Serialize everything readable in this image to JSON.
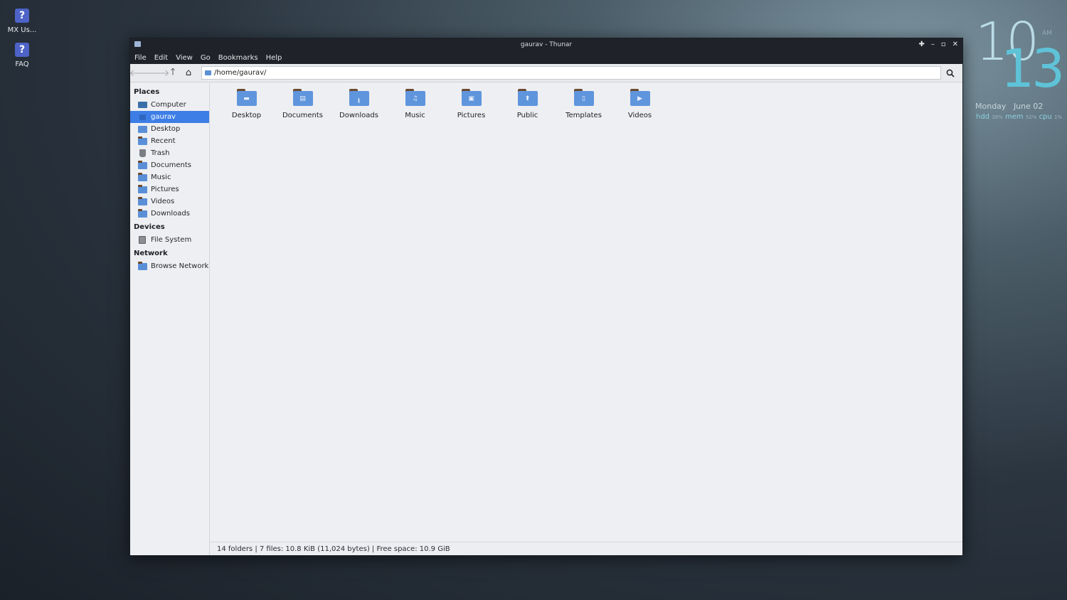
{
  "desktop": {
    "icons": [
      {
        "label": "MX Us...",
        "glyph": "?"
      },
      {
        "label": "FAQ",
        "glyph": "?"
      }
    ]
  },
  "clock": {
    "hour": "10",
    "minute": "13",
    "ampm": "AM",
    "day": "Monday",
    "date": "June 02",
    "hdd_label": "hdd",
    "hdd_value": "38%",
    "mem_label": "mem",
    "mem_value": "52%",
    "cpu_label": "cpu",
    "cpu_value": "1%"
  },
  "window": {
    "title": "gaurav - Thunar",
    "controls": {
      "pin": "✚",
      "minimize": "–",
      "maximize": "▫",
      "close": "✕"
    }
  },
  "menubar": [
    "File",
    "Edit",
    "View",
    "Go",
    "Bookmarks",
    "Help"
  ],
  "toolbar": {
    "back": "🡐",
    "forward": "🡒",
    "up": "🡑",
    "home": "⌂",
    "location": "/home/gaurav/"
  },
  "sidebar": {
    "places_heading": "Places",
    "places": [
      {
        "label": "Computer",
        "icon": "computer-icon"
      },
      {
        "label": "gaurav",
        "icon": "home-folder-icon",
        "active": true
      },
      {
        "label": "Desktop",
        "icon": "folder-icon"
      },
      {
        "label": "Recent",
        "icon": "folder-icon"
      },
      {
        "label": "Trash",
        "icon": "trash-icon"
      },
      {
        "label": "Documents",
        "icon": "folder-icon"
      },
      {
        "label": "Music",
        "icon": "folder-icon"
      },
      {
        "label": "Pictures",
        "icon": "folder-icon"
      },
      {
        "label": "Videos",
        "icon": "folder-icon"
      },
      {
        "label": "Downloads",
        "icon": "folder-icon"
      }
    ],
    "devices_heading": "Devices",
    "devices": [
      {
        "label": "File System",
        "icon": "drive-icon"
      }
    ],
    "network_heading": "Network",
    "network": [
      {
        "label": "Browse Network",
        "icon": "folder-icon"
      }
    ]
  },
  "main": {
    "folders": [
      {
        "label": "Desktop",
        "emblem": "▬"
      },
      {
        "label": "Documents",
        "emblem": "▤"
      },
      {
        "label": "Downloads",
        "emblem": "⭳"
      },
      {
        "label": "Music",
        "emblem": "♫"
      },
      {
        "label": "Pictures",
        "emblem": "▣"
      },
      {
        "label": "Public",
        "emblem": "⬆"
      },
      {
        "label": "Templates",
        "emblem": "▯"
      },
      {
        "label": "Videos",
        "emblem": "▶"
      }
    ]
  },
  "status": {
    "text": "14 folders  |  7 files: 10.8 KiB (11,024 bytes)  |  Free space: 10.9 GiB"
  },
  "colors": {
    "accent": "#3d7ee6",
    "folder": "#5f95dc",
    "titlebar": "#1f2329",
    "clock": "#5fc3d8"
  }
}
